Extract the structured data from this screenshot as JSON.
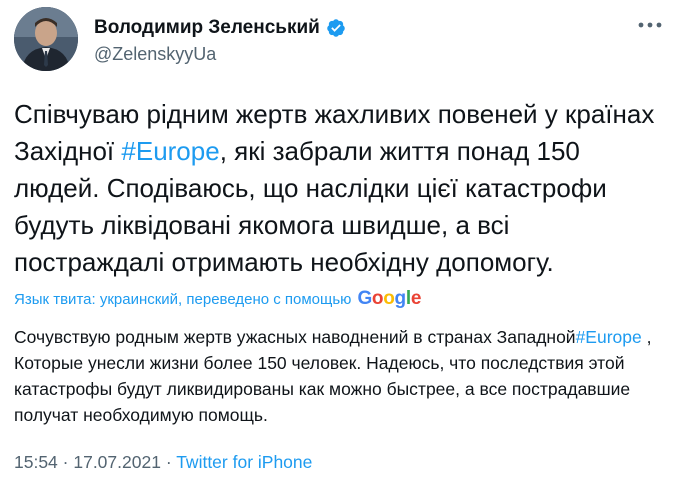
{
  "author": {
    "name": "Володимир Зеленський",
    "handle": "@ZelenskyyUa"
  },
  "tweet": {
    "text_before_hashtag": "Співчуваю рідним жертв жахливих повеней у країнах Західної ",
    "hashtag": "#Europe",
    "text_after_hashtag": ", які забрали життя понад 150 людей. Сподіваюсь, що наслідки цієї катастрофи будуть ліквідовані якомога швидше, а всі постраждалі отримають необхідну допомогу."
  },
  "translation_notice": {
    "label": "Язык твита: украинский, переведено с помощью",
    "provider": "Google"
  },
  "translation": {
    "text_before_hashtag": "Сочувствую родным жертв ужасных наводнений в странах Западной",
    "hashtag": "#Europe",
    "text_after_hashtag": " , Которые унесли жизни более 150 человек. Надеюсь, что последствия этой катастрофы будут ликвидированы как можно быстрее, а все пострадавшие получат необходимую помощь."
  },
  "meta": {
    "time": "15:54",
    "separator1": " · ",
    "date": "17.07.2021",
    "separator2": " · ",
    "source": "Twitter for iPhone"
  },
  "colors": {
    "accent": "#1d9bf0",
    "text": "#0f1419",
    "muted": "#536471"
  },
  "icons": {
    "verified": "verified-badge-icon",
    "more": "more-options-icon"
  }
}
